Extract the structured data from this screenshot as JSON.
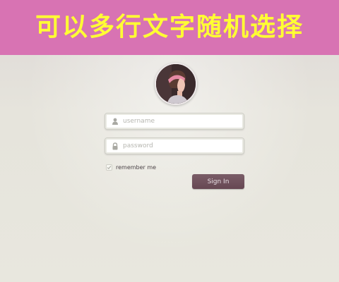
{
  "banner": {
    "text": "可以多行文字随机选择",
    "background": "#d873b3",
    "text_color": "#ffff33"
  },
  "login": {
    "avatar_icon": "profile-photo",
    "username": {
      "placeholder": "username",
      "value": "",
      "icon": "user-icon"
    },
    "password": {
      "placeholder": "password",
      "value": "",
      "icon": "lock-icon"
    },
    "remember": {
      "label": "remember me",
      "checked": true
    },
    "signin_label": "Sign In",
    "button_color": "#6e515c"
  }
}
